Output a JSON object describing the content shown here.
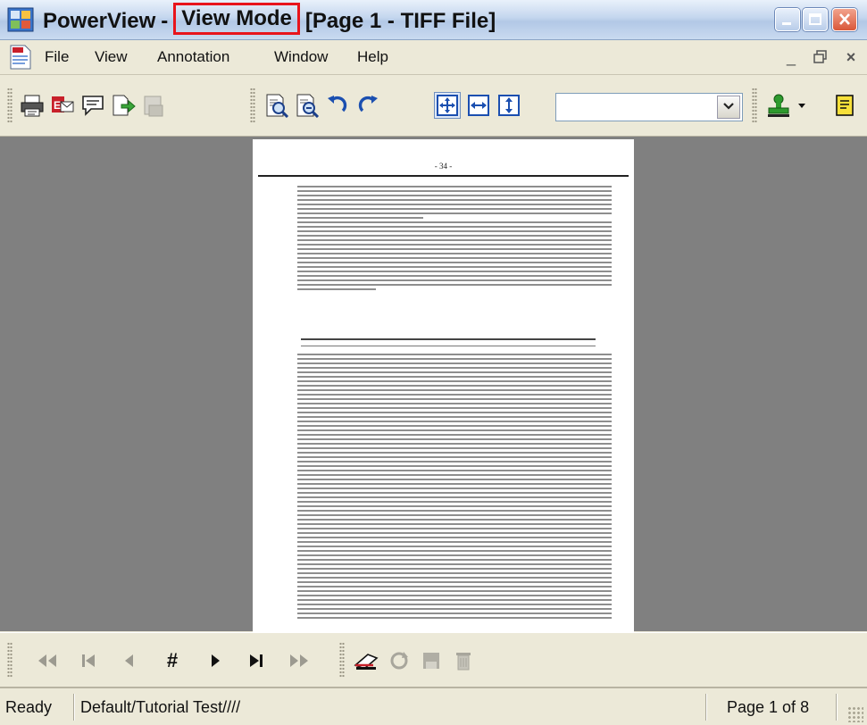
{
  "titlebar": {
    "app_name": "PowerView",
    "separator": "-",
    "mode": "View Mode",
    "document": "[Page 1 - TIFF File]"
  },
  "menubar": {
    "items": [
      "File",
      "View",
      "Annotation",
      "Window",
      "Help"
    ]
  },
  "toolbar": {
    "zoom_value": ""
  },
  "document": {
    "page_number": "- 34 -"
  },
  "statusbar": {
    "state": "Ready",
    "path": "Default/Tutorial Test////",
    "page": "Page 1 of 8"
  },
  "colors": {
    "mode_highlight": "#e8141b",
    "workspace": "#808080",
    "chrome": "#ece9d8"
  }
}
